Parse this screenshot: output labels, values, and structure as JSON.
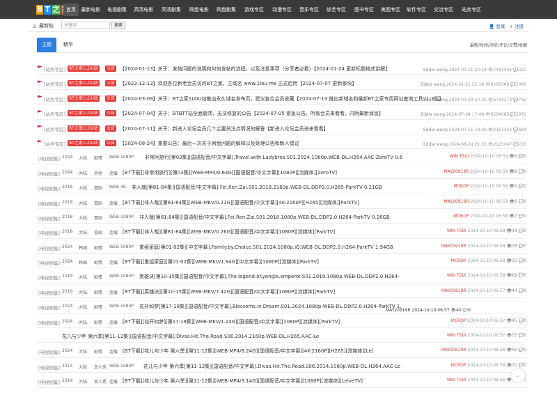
{
  "logo": {
    "letters": [
      "B",
      "T",
      "之",
      "家"
    ]
  },
  "nav": [
    {
      "label": "首页",
      "w": 22,
      "active": true
    },
    {
      "label": "最新电影",
      "w": 35
    },
    {
      "label": "电视剧集",
      "w": 40
    },
    {
      "label": "高清电影",
      "w": 37
    },
    {
      "label": "高清剧集",
      "w": 42
    },
    {
      "label": "网盘电影",
      "w": 38
    },
    {
      "label": "网盘剧集",
      "w": 40
    },
    {
      "label": "游戏专区",
      "w": 40
    },
    {
      "label": "动漫专区",
      "w": 40
    },
    {
      "label": "音乐专区",
      "w": 38
    },
    {
      "label": "综艺专区",
      "w": 40
    },
    {
      "label": "图书专区",
      "w": 40
    },
    {
      "label": "美图专区",
      "w": 36
    },
    {
      "label": "软件专区",
      "w": 38
    },
    {
      "label": "交流专区",
      "w": 40
    },
    {
      "label": "站务专区",
      "w": 40
    }
  ],
  "subbar": {
    "home": "最新帖",
    "search_placeholder": "关键词",
    "search_button": "搜索",
    "login": "登录",
    "register": "注册"
  },
  "tabs": {
    "active": "主题",
    "second": "精华",
    "sort": "最新/时间/浏览/评论/点赞/收藏"
  },
  "sticky": [
    {
      "cat": "[站务专区]",
      "b1": "BT之家1LOU站",
      "b2": "公告",
      "title": "【2024-01-13】关于：发帖问题的说明和如何发帖的流程，以及注意事项（分享者必看）【2024-01-24 更新标题格式讲解】",
      "author": "Eddie wang",
      "time": "2024-01-21 22:18",
      "views": "7441431",
      "replies": "322"
    },
    {
      "cat": "[站务专区]",
      "b1": "BT之家1LOU站",
      "b2": "公告",
      "title": "【2023-12-13】欢迎各位新老会员访问BT之家，主域名 www.1lou.me 正式启用【2024-07-07 更新板块】",
      "author": "Eddie wang",
      "time": "2024-01-21 22:18",
      "views": "8269366",
      "replies": "2000"
    },
    {
      "cat": "[站务专区]",
      "b1": "BT之家1LOU站",
      "b2": "公告",
      "title": "【2024-03-09】关于：BT之家1LOU站推出永久域名发布页，建议各位会员收藏【2024-07-13 推出新域名和最新BT之家专用网址查询工具V1.3版】",
      "author": "Eddie wang",
      "time": "2024-03-09 20:35",
      "views": "6754273",
      "replies": "792"
    },
    {
      "cat": "[站务专区]",
      "b1": "BT之家1LOU站",
      "b2": "公告",
      "title": "【2024-07-04】关于：BTBTT站全面崩溃，无法修复的公告【2024-07-05 紧急公告，所有会员来看看，内附最新消息】",
      "author": "Eddie wang",
      "time": "2024-07-04 17:48",
      "views": "6594085",
      "replies": "2970"
    },
    {
      "cat": "[站务专区]",
      "b1": "BT之家1LOU站",
      "b2": "公告",
      "title": "【2024-07-11】关于：新进入论坛会员几个主要关注点情况的解答【新进入论坛会员进来看看】",
      "author": "Eddie wang",
      "time": "2024-07-11 18:02",
      "views": "4163342",
      "replies": "694"
    },
    {
      "cat": "[站务专区]",
      "b1": "BT之家1LOU站",
      "b2": "公告",
      "title": "【2024-08-24】重要公告：最后一次关于网盘问题的解释以及处理公告和新人建议",
      "author": "Eddie wang",
      "time": "2024-08-24 21:55",
      "views": "2125047",
      "replies": "220"
    }
  ],
  "rows": [
    {
      "cat": "[电视剧集]",
      "tags": [
        "2024",
        "大陆",
        "剧情",
        "WEB-1080P"
      ],
      "title": "非常闲旅行[第03集][国语配音/中文字幕].Travel.with.Ladybros.S01.2024.1080p.WEB-DL.H264.AAC-ZeroTV 0.6",
      "author": "WIN TSUI",
      "time": "2024-10-10 06:59",
      "v": "9",
      "r": "0",
      "tl": 155
    },
    {
      "cat": "[电视剧集]",
      "tags": [
        "2024",
        "大陆",
        "其他",
        "连载"
      ],
      "title": "[BT下载][非常闲旅行][第03集][WEB-MP4/0.64G][国语配音/中文字幕][1080P][流媒体][ZeroTV]",
      "author": "MAY20919R",
      "time": "2024-10-10 06:59",
      "v": "8",
      "r": "0",
      "tl": 123
    },
    {
      "cat": "[电视剧集]",
      "tags": [
        "2018",
        "大陆",
        "喜剧",
        "WEB-4K"
      ],
      "title": "非人哉[第81-84集][国语配音/中文字幕].Fei.Ren.Zai.S01.2018.2160p.WEB-DL.DDP2.0.H265-ParkTV 0.21GB",
      "author": "MCROP",
      "time": "2024-10-10 06:59",
      "v": "5",
      "r": "0",
      "tl": 136
    },
    {
      "cat": "[电视剧集]",
      "tags": [
        "2018",
        "大陆",
        "喜剧",
        "连载"
      ],
      "title": "[BT下载][非人哉][第81-84集][WEB-MKV/0.21G][国语配音/中文字幕][4K-2160P][H265][流媒体][ParkTV]",
      "author": "MAY20919R",
      "time": "2024-10-10 06:59",
      "v": "6",
      "r": "0",
      "tl": 123
    },
    {
      "cat": "[电视剧集]",
      "tags": [
        "2018",
        "大陆",
        "喜剧",
        "WEB-1080P"
      ],
      "title": "非人哉[第81-84集][国语配音/中文字幕].Fei.Ren.Zai.S01.2018.1080p.WEB-DL.DDP2.0.H264-ParkTV 0.26GB",
      "author": "MCROP",
      "time": "2024-10-10 06:58",
      "v": "7",
      "r": "0",
      "tl": 147
    },
    {
      "cat": "[电视剧集]",
      "tags": [
        "2018",
        "大陆",
        "喜剧",
        "连载"
      ],
      "title": "[BT下载][非人哉][第81-84集][WEB-MKV/0.26G][国语配音/中文字幕][1080P][流媒体][ParkTV]",
      "author": "WIN TSUI",
      "time": "2024-10-10 06:58",
      "v": "48",
      "r": "0",
      "tl": 123
    },
    {
      "cat": "[电视剧集]",
      "tags": [
        "2024",
        "韩国",
        "剧情",
        "WEB-1080P"
      ],
      "title": "重组家庭[第01-02集][中文字幕].Family.by.Choice.S01.2024.1080p.iQ.WEB-DL.DDP2.0.H264-ParkTV 1.94GB",
      "author": "MAY20919R",
      "time": "2024-10-10 06:58",
      "v": "38",
      "r": "0",
      "tl": 147
    },
    {
      "cat": "[电视剧集]",
      "tags": [
        "2024",
        "韩国",
        "剧情",
        "连载"
      ],
      "title": "[BT下载][重组家庭][第01-02集][WEB-MKV/1.94G][中文字幕][1080P][流媒体][ParkTV]",
      "author": "MCROP",
      "time": "2024-10-10 06:58",
      "v": "33",
      "r": "0",
      "tl": 123
    },
    {
      "cat": "[电视剧集]",
      "tags": [
        "2019",
        "大陆",
        "剧情",
        "WEB-1080P"
      ],
      "title": "英雄诀[第10-15集][国语配音/中文字幕].The.legend.of.yongle.emperor.S01.2019.1080p.WEB-DL.DDP2.0.H264-",
      "author": "WIN TSUI",
      "time": "2024-10-10 06:58",
      "v": "62",
      "r": "0",
      "tl": 147
    },
    {
      "cat": "[电视剧集]",
      "tags": [
        "2019",
        "大陆",
        "剧情",
        "连载"
      ],
      "title": "[BT下载][英雄诀][第10-15集][WEB-MKV/7.42G][国语配音/中文字幕][1080P][流媒体][ParkTV]",
      "author": "MAY20919R",
      "time": "2024-10-10 06:57",
      "v": "44",
      "r": "0",
      "tl": 123
    },
    {
      "cat": "[电视剧集]",
      "tags": [
        "2024",
        "大陆",
        "剧情",
        "WEB-1080P"
      ],
      "title": "花开如梦[第17-18集][国语配音/中文字幕].Blossoms.in.Dream.S01.2024.1080p.WEB-DL.DDP2.0.H264-ParkTV 1.",
      "author": "MAY20919R",
      "time": "2024-10-10 06:57",
      "v": "40",
      "r": "0",
      "tl": 147,
      "two_line": true
    },
    {
      "cat": "[电视剧集]",
      "tags": [
        "2024",
        "大陆",
        "剧情",
        "连载"
      ],
      "title": "[BT下载][花开如梦][第17-18集][WEB-MKV/1.24G][国语配音/中文字幕][1080P][流媒体][ParkTV]",
      "author": "MCROP",
      "time": "2024-10-10 06:57",
      "v": "45",
      "r": "0",
      "tl": 123
    },
    {
      "cat": "",
      "tags": [],
      "title": "花儿与少年 第六季[第11-12集][国语配音/中文字幕].Divas.Hit.The.Road.S06.2014.2160p.WEB-DL.H265.AAC-Le",
      "author": "WIN TSUI",
      "time": "2024-10-10 06:57",
      "v": "53",
      "r": "0",
      "tl": 36
    },
    {
      "cat": "[电视剧集]",
      "tags": [
        "2024",
        "大陆",
        "剧情",
        "连载"
      ],
      "title": "[BT下载][花儿与少年 第六季][第11-12集][WEB-MP4/8.24G][国语配音/中文字幕][4K-2160P][H265][流媒体][Le]",
      "author": "MAY20919R",
      "time": "2024-10-10 06:56",
      "v": "56",
      "r": "0",
      "tl": 123
    },
    {
      "cat": "[电视剧集]",
      "tags": [
        "2014",
        "大陆",
        "真人秀",
        "WEB-1080P"
      ],
      "title": "花儿与少年 第六季[第11-12集][国语配音/中文字幕].Divas.Hit.The.Road.S06.2014.1080p.WEB-DL.H264.AAC-Le",
      "author": "MCROP",
      "time": "2024-10-10 06:56",
      "v": "71",
      "r": "0",
      "tl": 153
    },
    {
      "cat": "[电视剧集]",
      "tags": [
        "2014",
        "大陆",
        "真人秀",
        "连载"
      ],
      "title": "[BT下载][花儿与少年 第六季][第11-12集][WEB-MP4/3.14G][国语配音/中文字幕][1080P][流媒体][LelveTV]",
      "author": "WIN TSUI",
      "time": "2024-10-10 06:56",
      "v": "68",
      "r": "0",
      "tl": 123
    }
  ]
}
